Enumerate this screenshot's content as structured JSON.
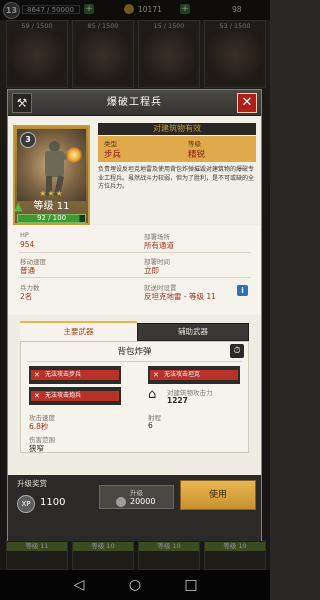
{
  "topbar": {
    "player_level": "13",
    "xp": "8647 / 50000",
    "currency_value": "10171",
    "gem_value": "98"
  },
  "background_cards": {
    "counts": [
      "59 / 1500",
      "85 / 1500",
      "15 / 1500",
      "53 / 1500"
    ],
    "bottom_levels": [
      "等级 11",
      "等级 10",
      "等级 10",
      "等级 10"
    ]
  },
  "modal": {
    "title": "爆破工程兵",
    "card": {
      "rank": "3",
      "level_label": "等级 11",
      "progress": "92 / 100",
      "progress_ratio": 0.92
    },
    "subtitle": "对建筑物有效",
    "info": {
      "type_label": "类型",
      "type_value": "步兵",
      "rank_label": "等级",
      "rank_value": "精锐"
    },
    "description": "负责埋设反坦克地雷及使用背包炸弹摧毁对建筑物的爆破专业工程兵。虽然战斗力较弱，但为了胜利，是不可或缺的全方位兵力。",
    "stats": [
      {
        "label": "HP",
        "value": "954"
      },
      {
        "label": "部署场所",
        "value": "所有通道"
      },
      {
        "label": "移动速度",
        "value": "普通"
      },
      {
        "label": "部署时间",
        "value": "立即"
      },
      {
        "label": "兵力数",
        "value": "2名"
      },
      {
        "label": "就送时设置",
        "value": "反坦克地雷 - 等级 11"
      }
    ],
    "tabs": {
      "main": "主要武器",
      "sub": "辅助武器"
    },
    "weapon": {
      "name": "背包炸弹",
      "bad_targets": [
        "无法攻击步兵",
        "无法攻击坦克",
        "无法攻击炮兵"
      ],
      "building_label": "对建筑物攻击力",
      "building_value": "1227",
      "attack_speed_label": "攻击速度",
      "attack_speed_value": "6.8秒",
      "range_label": "射程",
      "range_value": "6",
      "splash_label": "伤害范围",
      "splash_value": "狭窄"
    },
    "bottom": {
      "upgrade_reward_label": "升级奖赏",
      "xp_label": "XP",
      "xp_value": "1100",
      "upgrade_label": "升级",
      "upgrade_cost": "20000",
      "use_label": "使用"
    }
  },
  "colors": {
    "accent_gold": "#e0a94c",
    "close_red": "#b01e1a",
    "value_red": "#a0321f",
    "bad_target_red": "#b8322a"
  }
}
